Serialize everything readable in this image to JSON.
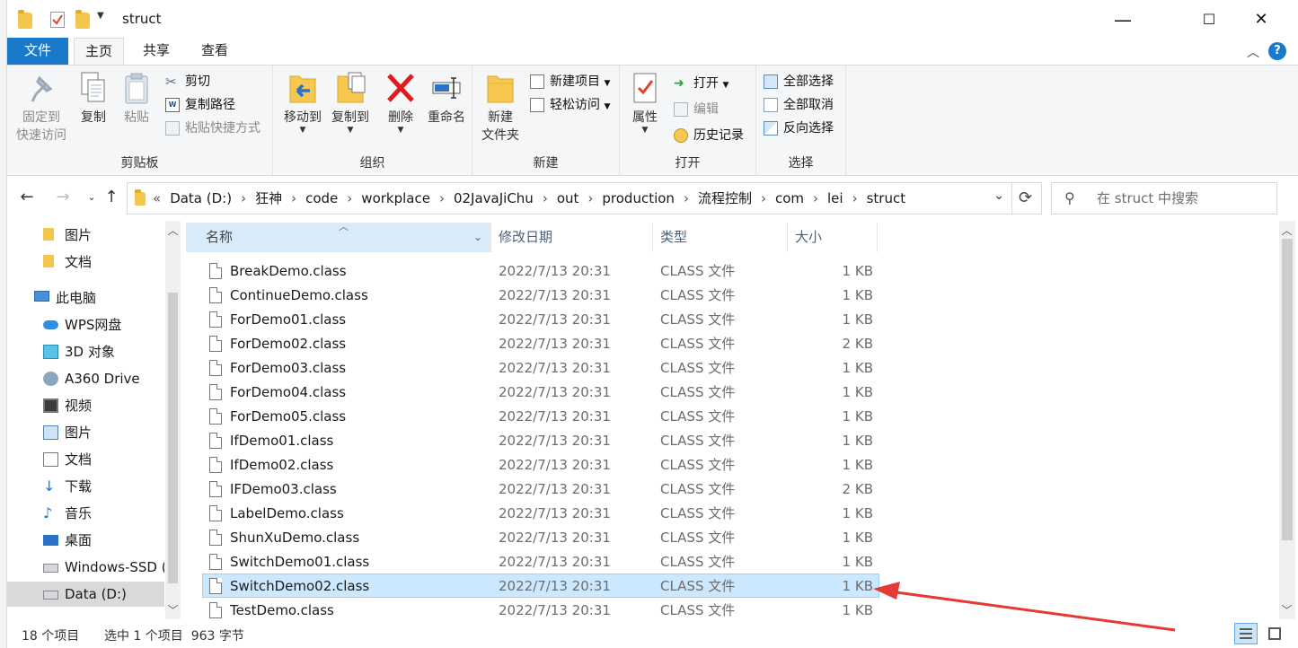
{
  "titlebar": {
    "title": "struct",
    "minimize": "—",
    "maximize": "☐",
    "close": "✕"
  },
  "tabs": {
    "file": "文件",
    "home": "主页",
    "share": "共享",
    "view": "查看",
    "collapse_icon": "chevron-up",
    "help": "?"
  },
  "ribbon": {
    "clipboard": {
      "label": "剪贴板",
      "pin": "固定到\n快速访问",
      "copy": "复制",
      "paste": "粘贴",
      "cut": "剪切",
      "copy_path": "复制路径",
      "paste_shortcut": "粘贴快捷方式"
    },
    "organize": {
      "label": "组织",
      "move_to": "移动到",
      "copy_to": "复制到",
      "delete": "删除",
      "rename": "重命名"
    },
    "new": {
      "label": "新建",
      "new_folder": "新建\n文件夹",
      "new_item": "新建项目",
      "easy_access": "轻松访问"
    },
    "open": {
      "label": "打开",
      "properties": "属性",
      "open": "打开",
      "edit": "编辑",
      "history": "历史记录"
    },
    "select": {
      "label": "选择",
      "select_all": "全部选择",
      "select_none": "全部取消",
      "invert": "反向选择"
    }
  },
  "address": {
    "prefix": "«",
    "crumbs": [
      "Data (D:)",
      "狂神",
      "code",
      "workplace",
      "02JavaJiChu",
      "out",
      "production",
      "流程控制",
      "com",
      "lei",
      "struct"
    ],
    "search_placeholder": "在 struct 中搜索"
  },
  "navpane": {
    "items": [
      {
        "label": "图片",
        "icon": "folder-icon"
      },
      {
        "label": "文档",
        "icon": "folder-icon"
      },
      {
        "label": "此电脑",
        "icon": "computer-icon"
      },
      {
        "label": "WPS网盘",
        "icon": "cloud-icon"
      },
      {
        "label": "3D 对象",
        "icon": "cube-icon"
      },
      {
        "label": "A360 Drive",
        "icon": "drive-icon"
      },
      {
        "label": "视频",
        "icon": "film-icon"
      },
      {
        "label": "图片",
        "icon": "picture-icon"
      },
      {
        "label": "文档",
        "icon": "document-icon"
      },
      {
        "label": "下载",
        "icon": "download-icon"
      },
      {
        "label": "音乐",
        "icon": "music-icon"
      },
      {
        "label": "桌面",
        "icon": "desktop-icon"
      },
      {
        "label": "Windows-SSD (",
        "icon": "disk-icon"
      },
      {
        "label": "Data (D:)",
        "icon": "disk-icon"
      }
    ]
  },
  "columns": {
    "name": "名称",
    "date": "修改日期",
    "type": "类型",
    "size": "大小"
  },
  "files": [
    {
      "name": "BreakDemo.class",
      "date": "2022/7/13 20:31",
      "type": "CLASS 文件",
      "size": "1 KB"
    },
    {
      "name": "ContinueDemo.class",
      "date": "2022/7/13 20:31",
      "type": "CLASS 文件",
      "size": "1 KB"
    },
    {
      "name": "ForDemo01.class",
      "date": "2022/7/13 20:31",
      "type": "CLASS 文件",
      "size": "1 KB"
    },
    {
      "name": "ForDemo02.class",
      "date": "2022/7/13 20:31",
      "type": "CLASS 文件",
      "size": "2 KB"
    },
    {
      "name": "ForDemo03.class",
      "date": "2022/7/13 20:31",
      "type": "CLASS 文件",
      "size": "1 KB"
    },
    {
      "name": "ForDemo04.class",
      "date": "2022/7/13 20:31",
      "type": "CLASS 文件",
      "size": "1 KB"
    },
    {
      "name": "ForDemo05.class",
      "date": "2022/7/13 20:31",
      "type": "CLASS 文件",
      "size": "1 KB"
    },
    {
      "name": "IfDemo01.class",
      "date": "2022/7/13 20:31",
      "type": "CLASS 文件",
      "size": "1 KB"
    },
    {
      "name": "IfDemo02.class",
      "date": "2022/7/13 20:31",
      "type": "CLASS 文件",
      "size": "1 KB"
    },
    {
      "name": "IFDemo03.class",
      "date": "2022/7/13 20:31",
      "type": "CLASS 文件",
      "size": "2 KB"
    },
    {
      "name": "LabelDemo.class",
      "date": "2022/7/13 20:31",
      "type": "CLASS 文件",
      "size": "1 KB"
    },
    {
      "name": "ShunXuDemo.class",
      "date": "2022/7/13 20:31",
      "type": "CLASS 文件",
      "size": "1 KB"
    },
    {
      "name": "SwitchDemo01.class",
      "date": "2022/7/13 20:31",
      "type": "CLASS 文件",
      "size": "1 KB"
    },
    {
      "name": "SwitchDemo02.class",
      "date": "2022/7/13 20:31",
      "type": "CLASS 文件",
      "size": "1 KB",
      "selected": true
    },
    {
      "name": "TestDemo.class",
      "date": "2022/7/13 20:31",
      "type": "CLASS 文件",
      "size": "1 KB"
    }
  ],
  "status": {
    "count": "18 个项目",
    "selection": "选中 1 个项目  963 字节"
  },
  "colors": {
    "accent": "#1979ca",
    "selection": "#cce8ff",
    "annotation": "#e53935"
  }
}
